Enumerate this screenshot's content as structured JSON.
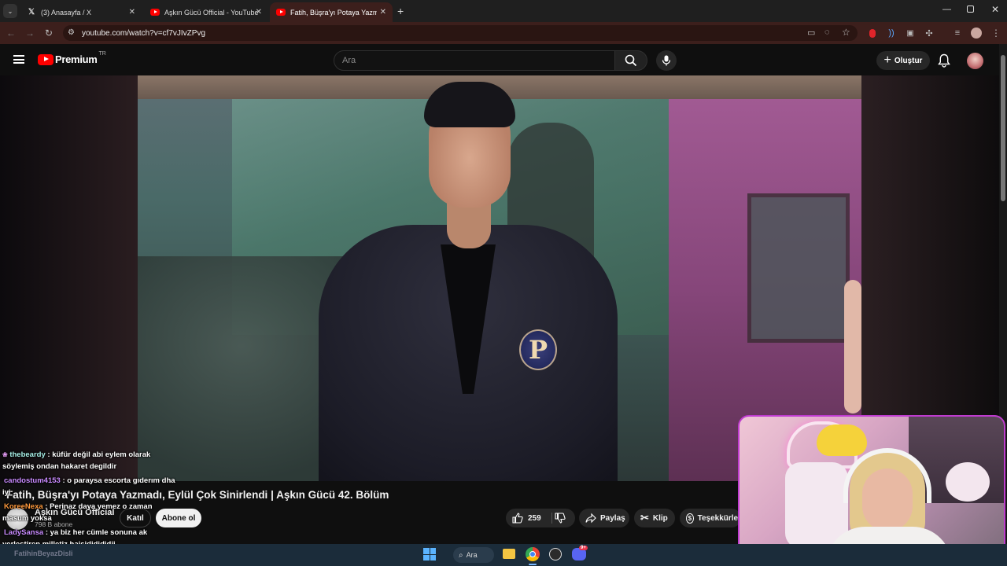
{
  "browser": {
    "tabs": [
      {
        "title": "(3) Anasayfa / X",
        "icon": "x-logo-icon"
      },
      {
        "title": "Aşkın Gücü Official - YouTube",
        "icon": "youtube-icon"
      },
      {
        "title": "Fatih, Büşra'yı Potaya Yazmadı,",
        "icon": "youtube-icon"
      }
    ],
    "url": "youtube.com/watch?v=cf7vJIvZPvg"
  },
  "youtube": {
    "logo_text": "Premium",
    "region": "TR",
    "search_placeholder": "Ara",
    "create_label": "Oluştur"
  },
  "video": {
    "title": "Fatih, Büşra'yı Potaya Yazmadı, Eylül Çok Sinirlendi | Aşkın Gücü 42. Bölüm",
    "channel": "Aşkın Gücü Official",
    "subscribers": "798 B abone",
    "join_label": "Katıl",
    "subscribe_label": "Abone ol",
    "likes": "259",
    "share_label": "Paylaş",
    "clip_label": "Klip",
    "thanks_label": "Teşekkürler",
    "badge_letter": "P"
  },
  "chat": [
    {
      "user": "thebeardy",
      "user_color": "#a8f0e8",
      "text": ": küfür değil abi eylem olarak",
      "cont": "söylemiş ondan hakaret degildir"
    },
    {
      "user": "candostum4153",
      "user_color": "#c98bff",
      "text": ": o paraysa escorta gıderım dha",
      "cont": "iyi"
    },
    {
      "user": "KoreeNexa",
      "user_color": "#ff9a3c",
      "text": ": Perinaz daya yemez o zaman",
      "cont": "masum yoksa"
    },
    {
      "user": "LadySansa",
      "user_color": "#c98bff",
      "text": ": ya biz her cümle sonuna ak",
      "cont": "yerleştiren milletiz hajsjdjdjdjdjj"
    }
  ],
  "chat_footer": "FatihinBeyazDisli",
  "taskbar": {
    "search_label": "Ara",
    "discord_badge": "9+"
  },
  "colors": {
    "youtube_red": "#ff0000",
    "tab_active": "#3c1f1c",
    "webcam_border": "#c03bd0"
  }
}
